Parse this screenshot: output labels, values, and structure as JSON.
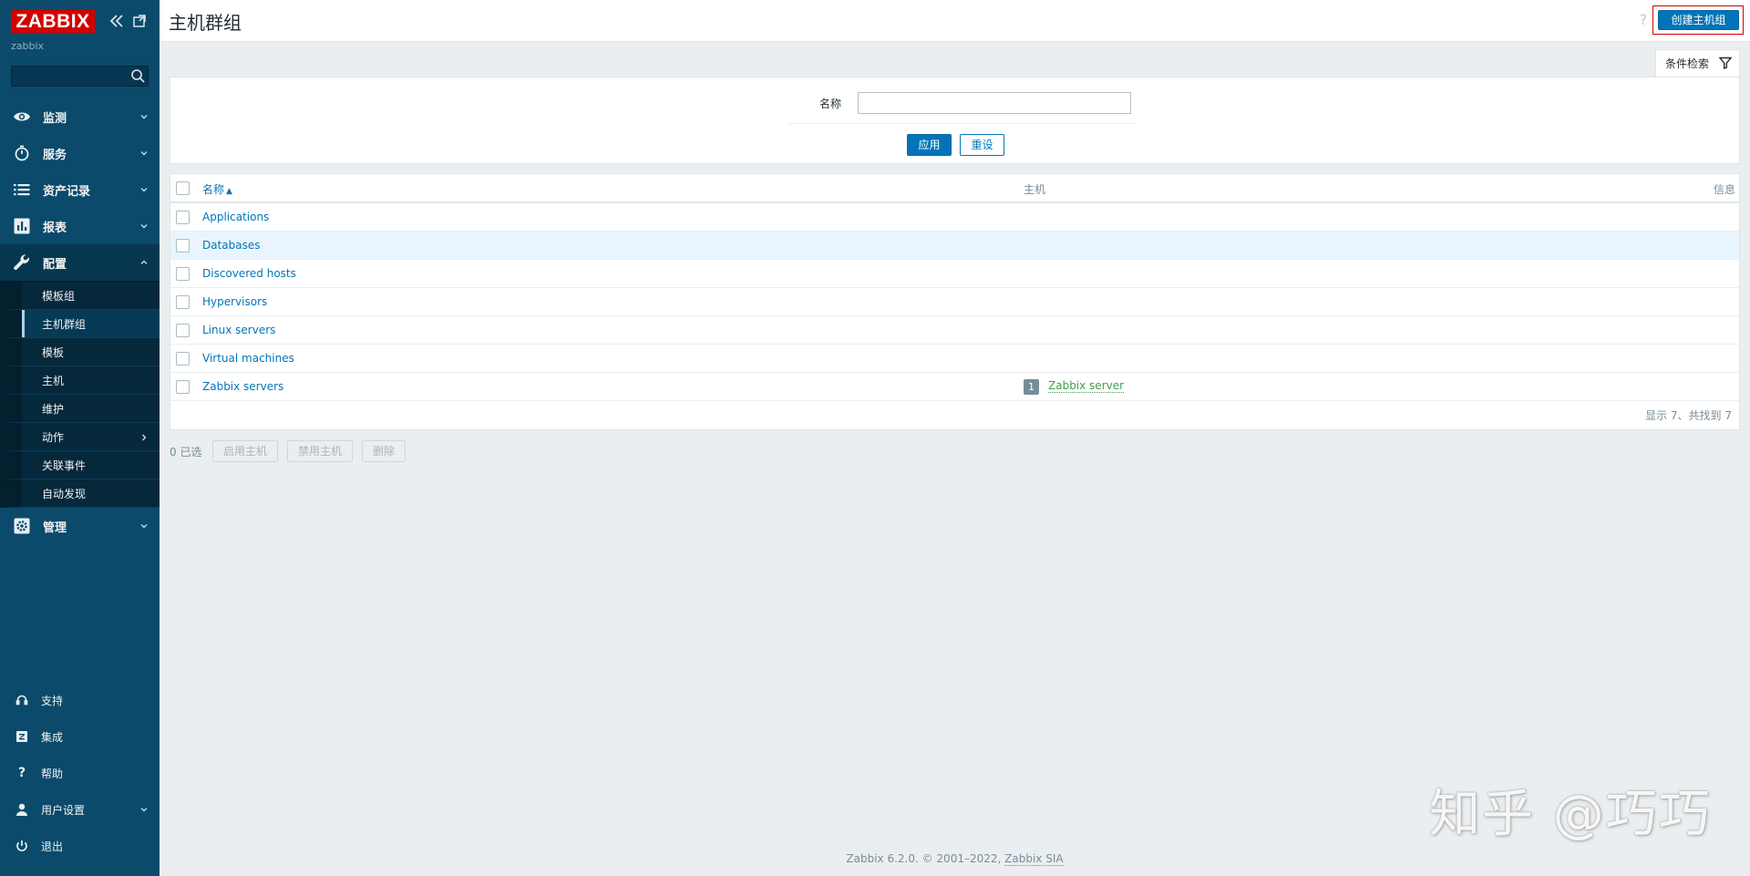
{
  "sidebar": {
    "logo": "ZABBIX",
    "server_name": "zabbix",
    "search": {
      "value": "",
      "placeholder": ""
    },
    "menu": {
      "monitoring": "监测",
      "services": "服务",
      "inventory": "资产记录",
      "reports": "报表",
      "configuration": "配置",
      "administration": "管理"
    },
    "config_submenu": {
      "template_groups": "模板组",
      "host_groups": "主机群组",
      "templates": "模板",
      "hosts": "主机",
      "maintenance": "维护",
      "actions": "动作",
      "event_correlation": "关联事件",
      "discovery": "自动发现"
    },
    "bottom": {
      "support": "支持",
      "integrations": "集成",
      "help": "帮助",
      "user_settings": "用户设置",
      "sign_out": "退出"
    }
  },
  "header": {
    "title": "主机群组",
    "help": "?",
    "create_button": "创建主机组"
  },
  "filter": {
    "tab_label": "条件检索",
    "name_label": "名称",
    "name_value": "",
    "apply": "应用",
    "reset": "重设"
  },
  "table": {
    "columns": {
      "name": "名称",
      "hosts": "主机",
      "info": "信息"
    },
    "sort_indicator": "▲",
    "rows": [
      {
        "name": "Applications"
      },
      {
        "name": "Databases"
      },
      {
        "name": "Discovered hosts"
      },
      {
        "name": "Hypervisors"
      },
      {
        "name": "Linux servers"
      },
      {
        "name": "Virtual machines"
      },
      {
        "name": "Zabbix servers",
        "host_count": "1",
        "host": "Zabbix server"
      }
    ],
    "footer": "显示 7、共找到 7"
  },
  "actions": {
    "selected": "0 已选",
    "enable": "启用主机",
    "disable": "禁用主机",
    "delete": "删除"
  },
  "footer": {
    "text": "Zabbix 6.2.0. © 2001–2022,",
    "company": "Zabbix SIA"
  },
  "watermark": "知乎 @巧巧",
  "colors": {
    "sidebar": "#0b4a6b",
    "primary": "#0275b8",
    "logo": "#d40000",
    "host_link": "#429e47"
  }
}
